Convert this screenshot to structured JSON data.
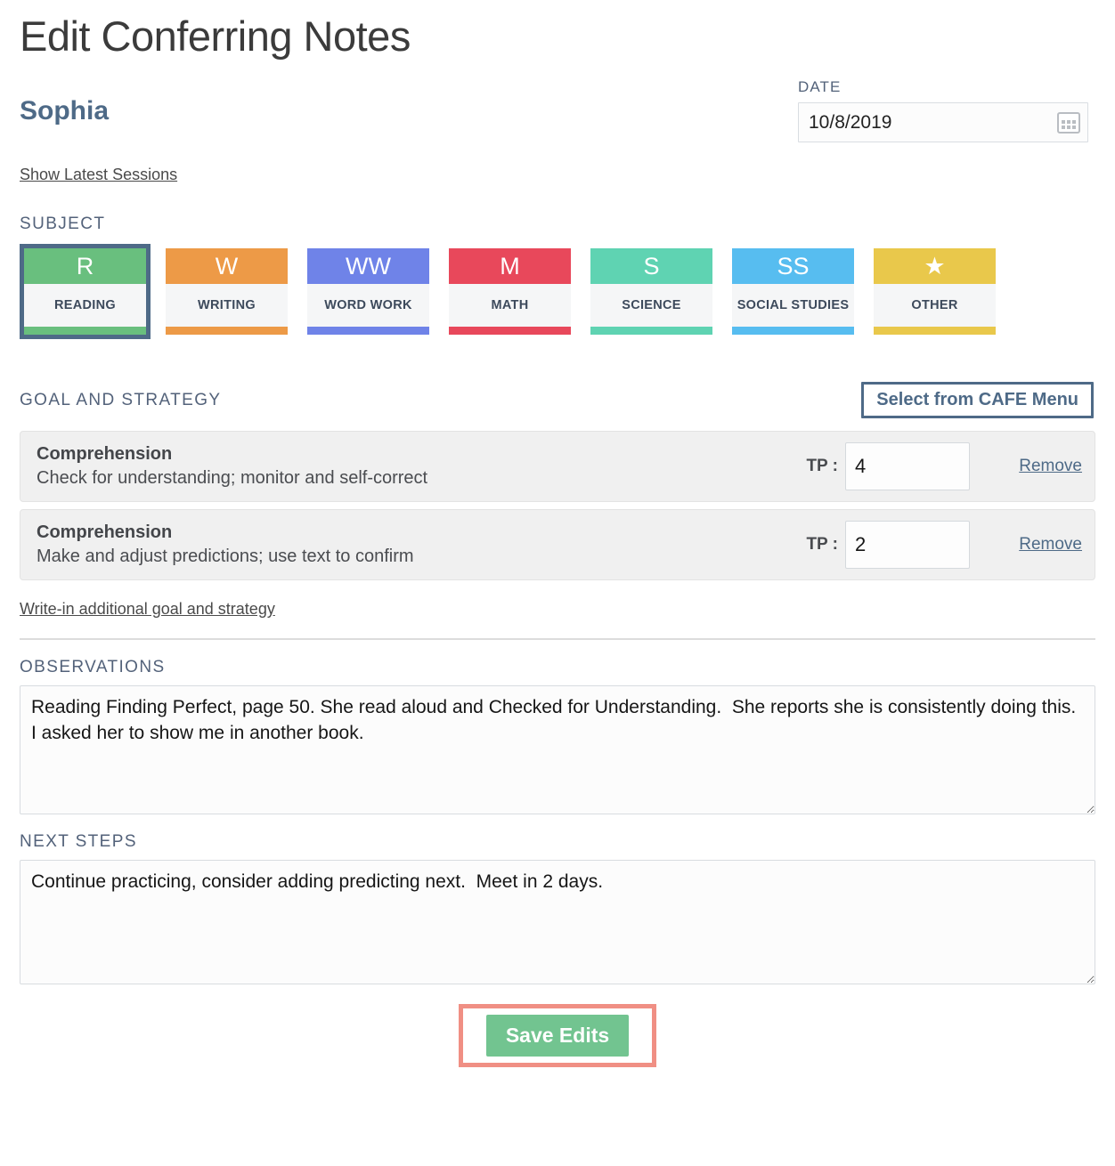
{
  "page": {
    "title": "Edit Conferring Notes",
    "student_name": "Sophia",
    "show_latest_sessions_label": "Show Latest Sessions"
  },
  "date": {
    "label": "DATE",
    "value": "10/8/2019",
    "icon": "calendar-icon"
  },
  "subject": {
    "label": "SUBJECT",
    "selected": "READING",
    "tiles": [
      {
        "abbr": "R",
        "label": "READING",
        "color": "#69bf7e",
        "selected": true
      },
      {
        "abbr": "W",
        "label": "WRITING",
        "color": "#ed9a47",
        "selected": false
      },
      {
        "abbr": "WW",
        "label": "WORD WORK",
        "color": "#6f83e8",
        "selected": false
      },
      {
        "abbr": "M",
        "label": "MATH",
        "color": "#e8485b",
        "selected": false
      },
      {
        "abbr": "S",
        "label": "SCIENCE",
        "color": "#5fd3b2",
        "selected": false
      },
      {
        "abbr": "SS",
        "label": "SOCIAL STUDIES",
        "color": "#57bdf0",
        "selected": false
      },
      {
        "abbr": "★",
        "label": "OTHER",
        "color": "#e9c council",
        "selected": false
      }
    ]
  },
  "goal_section": {
    "label": "GOAL AND STRATEGY",
    "cafe_button_label": "Select from CAFE Menu",
    "tp_label": "TP :",
    "remove_label": "Remove",
    "writein_label": "Write-in additional goal and strategy",
    "rows": [
      {
        "title": "Comprehension",
        "description": "Check for understanding; monitor and self-correct",
        "tp_value": "4"
      },
      {
        "title": "Comprehension",
        "description": "Make and adjust predictions; use text to confirm",
        "tp_value": "2"
      }
    ]
  },
  "observations": {
    "label": "OBSERVATIONS",
    "value": "Reading Finding Perfect, page 50. She read aloud and Checked for Understanding.  She reports she is consistently doing this. I asked her to show me in another book."
  },
  "next_steps": {
    "label": "NEXT STEPS",
    "value": "Continue practicing, consider adding predicting next.  Meet in 2 days."
  },
  "save": {
    "label": "Save Edits",
    "button_color": "#72c490",
    "highlight_color": "#f08f84"
  },
  "colors": {
    "accent": "#4e6a87",
    "heading": "#3b3b3b"
  }
}
